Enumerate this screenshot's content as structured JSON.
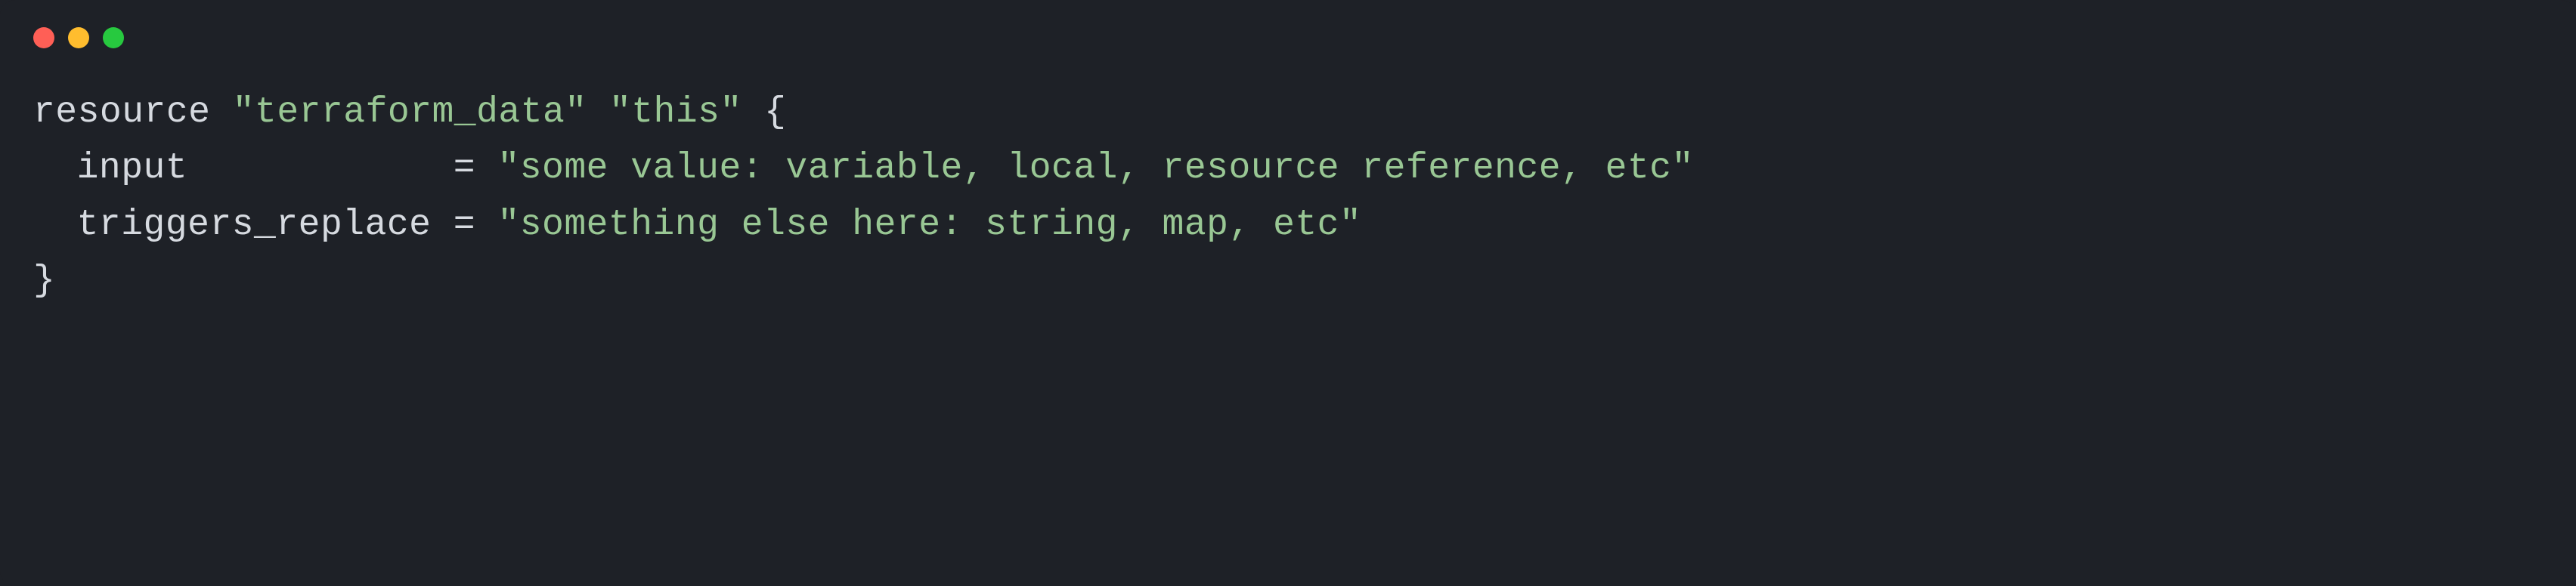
{
  "code": {
    "line1": {
      "keyword": "resource",
      "type": "\"terraform_data\"",
      "name": "\"this\"",
      "brace": "{"
    },
    "line2": {
      "attr": "input",
      "pad": "           ",
      "eq": " = ",
      "value": "\"some value: variable, local, resource reference, etc\""
    },
    "line3": {
      "attr": "triggers_replace",
      "eq": " = ",
      "value": "\"something else here: string, map, etc\""
    },
    "line4": {
      "brace": "}"
    }
  }
}
